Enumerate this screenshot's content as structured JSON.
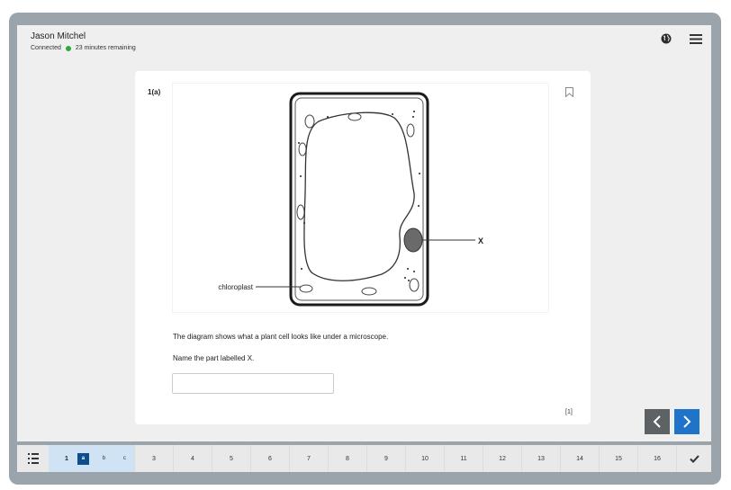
{
  "header": {
    "user_name": "Jason Mitchel",
    "connection": "Connected",
    "time_remaining": "23 minutes remaining"
  },
  "question": {
    "number": "1(a)",
    "diagram_label_chloroplast": "chloroplast",
    "diagram_label_x": "X",
    "text": "The diagram shows what a plant cell looks like under a microscope.",
    "prompt": "Name the part labelled X.",
    "answer_value": "",
    "marks": "[1]"
  },
  "navigator": {
    "current_question": "1",
    "sub_parts": [
      {
        "label": "a",
        "active": true
      },
      {
        "label": "b",
        "active": false
      },
      {
        "label": "c",
        "active": false
      }
    ],
    "questions": [
      "3",
      "4",
      "5",
      "6",
      "7",
      "8",
      "9",
      "10",
      "11",
      "12",
      "13",
      "14",
      "15",
      "16"
    ]
  },
  "icons": {
    "globe": "globe-icon",
    "menu": "hamburger-menu-icon",
    "bookmark": "bookmark-icon",
    "prev": "chevron-left-icon",
    "next": "chevron-right-icon",
    "list": "list-icon",
    "check": "checkmark-icon"
  },
  "colors": {
    "frame": "#9aa4aa",
    "connected_dot": "#2faa3a",
    "next_button": "#1f73c9",
    "prev_button": "#5d6265",
    "active_subpart": "#0d4f8c",
    "question_group_bg": "#cfe3f5"
  }
}
